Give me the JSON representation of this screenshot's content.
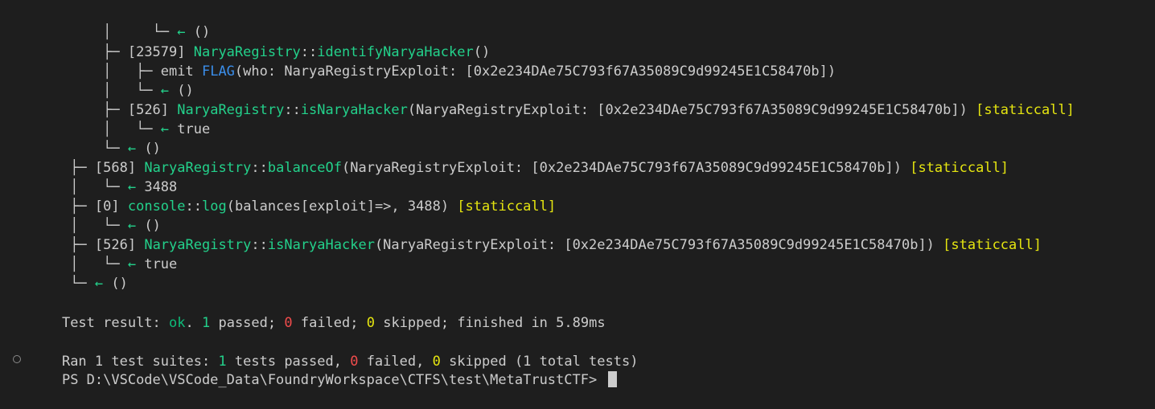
{
  "lines": [
    {
      "tree": "     │     └─ ",
      "arrow": "← ",
      "tail": "()"
    },
    {
      "tree": "     ├─ ",
      "gas": "[23579] ",
      "contract": "NaryaRegistry",
      "sep": "::",
      "fn": "identifyNaryaHacker",
      "args": "()"
    },
    {
      "tree": "     │   ├─ ",
      "emit": "emit ",
      "event": "FLAG",
      "args": "(who: NaryaRegistryExploit: [0x2e234DAe75C793f67A35089C9d99245E1C58470b])"
    },
    {
      "tree": "     │   └─ ",
      "arrow": "← ",
      "tail": "()"
    },
    {
      "tree": "     ├─ ",
      "gas": "[526] ",
      "contract": "NaryaRegistry",
      "sep": "::",
      "fn": "isNaryaHacker",
      "args": "(NaryaRegistryExploit: [0x2e234DAe75C793f67A35089C9d99245E1C58470b]) ",
      "tag": "[staticcall]"
    },
    {
      "tree": "     │   └─ ",
      "arrow": "← ",
      "tail": "true"
    },
    {
      "tree": "     └─ ",
      "arrow": "← ",
      "tail": "()"
    },
    {
      "tree": " ├─ ",
      "gas": "[568] ",
      "contract": "NaryaRegistry",
      "sep": "::",
      "fn": "balanceOf",
      "args": "(NaryaRegistryExploit: [0x2e234DAe75C793f67A35089C9d99245E1C58470b]) ",
      "tag": "[staticcall]"
    },
    {
      "tree": " │   └─ ",
      "arrow": "← ",
      "tail": "3488"
    },
    {
      "tree": " ├─ ",
      "gas": "[0] ",
      "contract": "console",
      "sep": "::",
      "fn": "log",
      "args": "(balances[exploit]=>, 3488) ",
      "tag": "[staticcall]"
    },
    {
      "tree": " │   └─ ",
      "arrow": "← ",
      "tail": "()"
    },
    {
      "tree": " ├─ ",
      "gas": "[526] ",
      "contract": "NaryaRegistry",
      "sep": "::",
      "fn": "isNaryaHacker",
      "args": "(NaryaRegistryExploit: [0x2e234DAe75C793f67A35089C9d99245E1C58470b]) ",
      "tag": "[staticcall]"
    },
    {
      "tree": " │   └─ ",
      "arrow": "← ",
      "tail": "true"
    },
    {
      "tree": " └─ ",
      "arrow": "← ",
      "tail": "()"
    }
  ],
  "result": {
    "prefix": "Test result: ",
    "ok": "ok",
    "dot": ". ",
    "passed_n": "1",
    "passed_t": " passed; ",
    "failed_n": "0",
    "failed_t": " failed; ",
    "skipped_n": "0",
    "skipped_t": " skipped; finished in 5.89ms"
  },
  "summary": {
    "prefix": "Ran 1 test suites: ",
    "tests_n": "1",
    "tests_t": " tests passed, ",
    "failed_n": "0",
    "failed_t": " failed, ",
    "skipped_n": "0",
    "skipped_t": " skipped (1 total tests)"
  },
  "prompt": {
    "text": "PS D:\\VSCode\\VSCode_Data\\FoundryWorkspace\\CTFS\\test\\MetaTrustCTF> "
  }
}
